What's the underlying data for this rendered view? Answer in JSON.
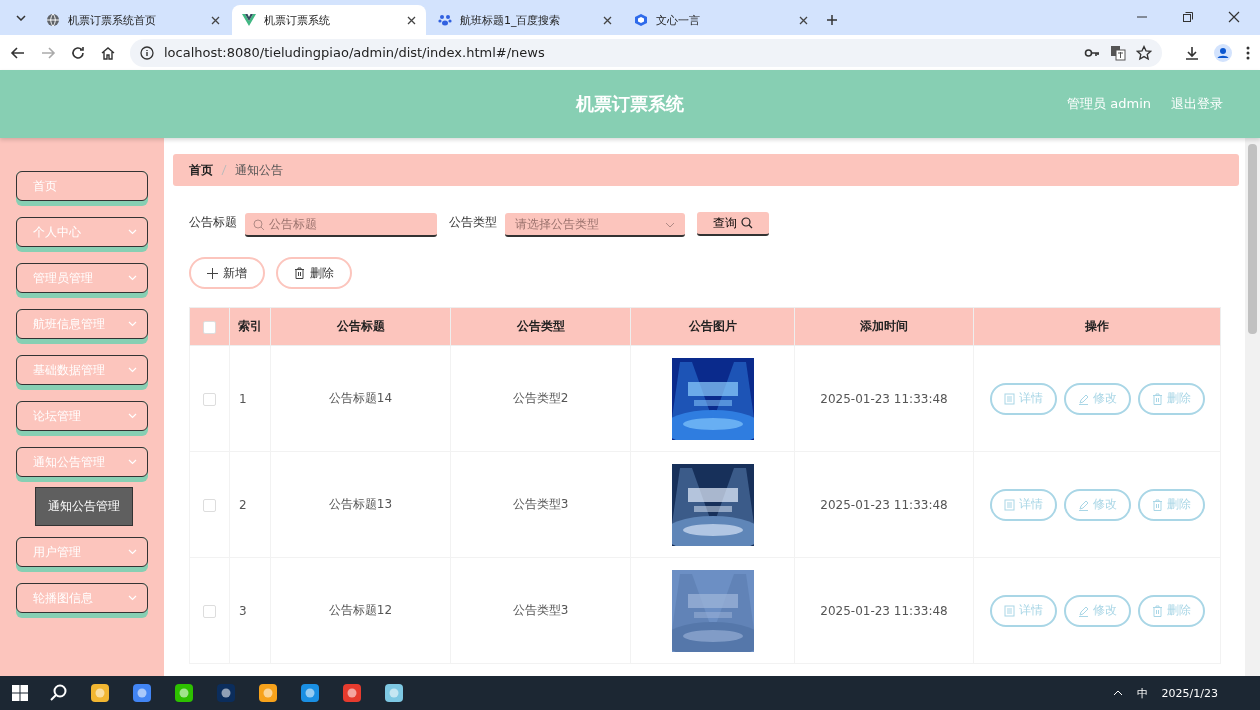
{
  "browser": {
    "tabs": [
      {
        "title": "机票订票系统首页",
        "selected": false
      },
      {
        "title": "机票订票系统",
        "selected": true
      },
      {
        "title": "航班标题1_百度搜索",
        "selected": false
      },
      {
        "title": "文心一言",
        "selected": false
      }
    ],
    "url": "localhost:8080/tieludingpiao/admin/dist/index.html#/news"
  },
  "header": {
    "title": "机票订票系统",
    "user": "管理员 admin",
    "logout": "退出登录"
  },
  "sidebar": {
    "items": [
      {
        "label": "首页",
        "kind": "link"
      },
      {
        "label": "个人中心",
        "kind": "menu"
      },
      {
        "label": "管理员管理",
        "kind": "menu"
      },
      {
        "label": "航班信息管理",
        "kind": "menu"
      },
      {
        "label": "基础数据管理",
        "kind": "menu"
      },
      {
        "label": "论坛管理",
        "kind": "menu"
      },
      {
        "label": "通知公告管理",
        "kind": "menu",
        "tooltip": "通知公告管理"
      },
      {
        "label": "用户管理",
        "kind": "menu"
      },
      {
        "label": "轮播图信息",
        "kind": "menu"
      }
    ]
  },
  "breadcrumb": [
    "首页",
    "通知公告"
  ],
  "search": {
    "title_label": "公告标题",
    "title_placeholder": "公告标题",
    "type_label": "公告类型",
    "type_placeholder": "请选择公告类型",
    "query_button": "查询"
  },
  "actions": {
    "add": "新增",
    "delete": "删除"
  },
  "table": {
    "all_checked": false,
    "columns": [
      "索引",
      "公告标题",
      "公告类型",
      "公告图片",
      "添加时间",
      "操作"
    ],
    "rows": [
      {
        "index": "1",
        "title": "公告标题14",
        "type": "公告类型2",
        "image": {
          "kind": "picture"
        },
        "time": "2025-01-23 11:33:48",
        "checked": false,
        "actions": [
          "详情",
          "修改",
          "删除"
        ]
      },
      {
        "index": "2",
        "title": "公告标题13",
        "type": "公告类型3",
        "image": {
          "kind": "picture"
        },
        "time": "2025-01-23 11:33:48",
        "checked": false,
        "actions": [
          "详情",
          "修改",
          "删除"
        ]
      },
      {
        "index": "3",
        "title": "公告标题12",
        "type": "公告类型3",
        "image": {
          "kind": "picture"
        },
        "time": "2025-01-23 11:33:48",
        "checked": false,
        "actions": [
          "详情",
          "修改",
          "删除"
        ]
      }
    ]
  },
  "taskbar": {
    "ime": "中",
    "date": "2025/1/23"
  }
}
